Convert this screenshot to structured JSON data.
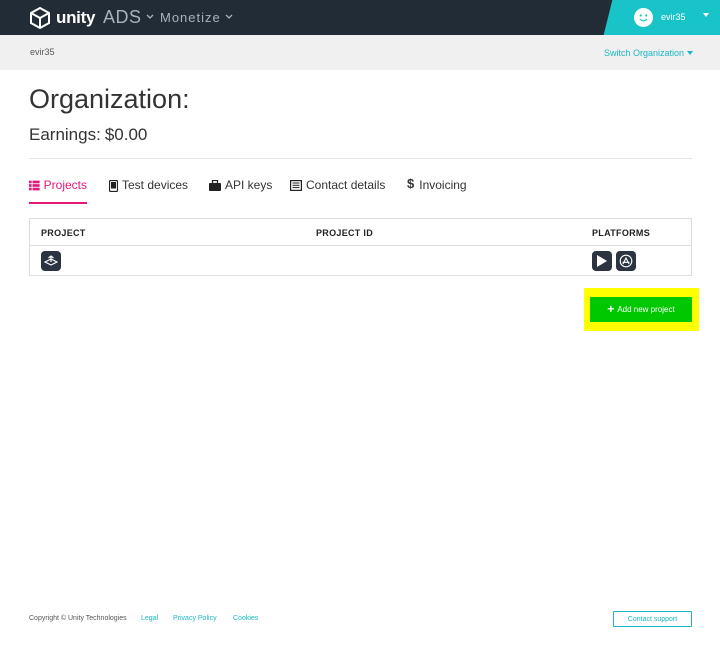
{
  "topbar": {
    "logo_text": "unity",
    "product": "ADS",
    "section": "Monetize",
    "user": {
      "name": "evir35",
      "caret": "▾"
    }
  },
  "subbar": {
    "user": "evir35",
    "switch_org_label": "Switch Organization"
  },
  "page": {
    "title": "Organization:",
    "earnings_label": "Earnings:",
    "earnings_value": "$0.00"
  },
  "tabs": [
    {
      "label": "Projects",
      "icon": "list-icon",
      "active": true
    },
    {
      "label": "Test devices",
      "icon": "mobile-icon",
      "active": false
    },
    {
      "label": "API keys",
      "icon": "briefcase-icon",
      "active": false
    },
    {
      "label": "Contact details",
      "icon": "document-icon",
      "active": false
    },
    {
      "label": "Invoicing",
      "icon": "dollar-icon",
      "active": false
    }
  ],
  "table": {
    "columns": [
      "PROJECT",
      "PROJECT ID",
      "PLATFORMS"
    ],
    "rows": [
      {
        "project_icon": "unity-cube-icon",
        "project_id": "",
        "platforms": [
          "google-play-icon",
          "app-store-icon"
        ]
      }
    ]
  },
  "add_project": {
    "plus": "+",
    "label": "Add new project"
  },
  "footer": {
    "copyright": "Copyright © Unity Technologies",
    "links": [
      "Legal",
      "Privacy Policy",
      "Cookies"
    ],
    "contact_label": "Contact support"
  },
  "colors": {
    "topbar_bg": "#222c37",
    "accent_teal": "#19c4c8",
    "active_tab": "#e2187b",
    "add_button": "#00c800",
    "highlight": "#ffff00"
  }
}
